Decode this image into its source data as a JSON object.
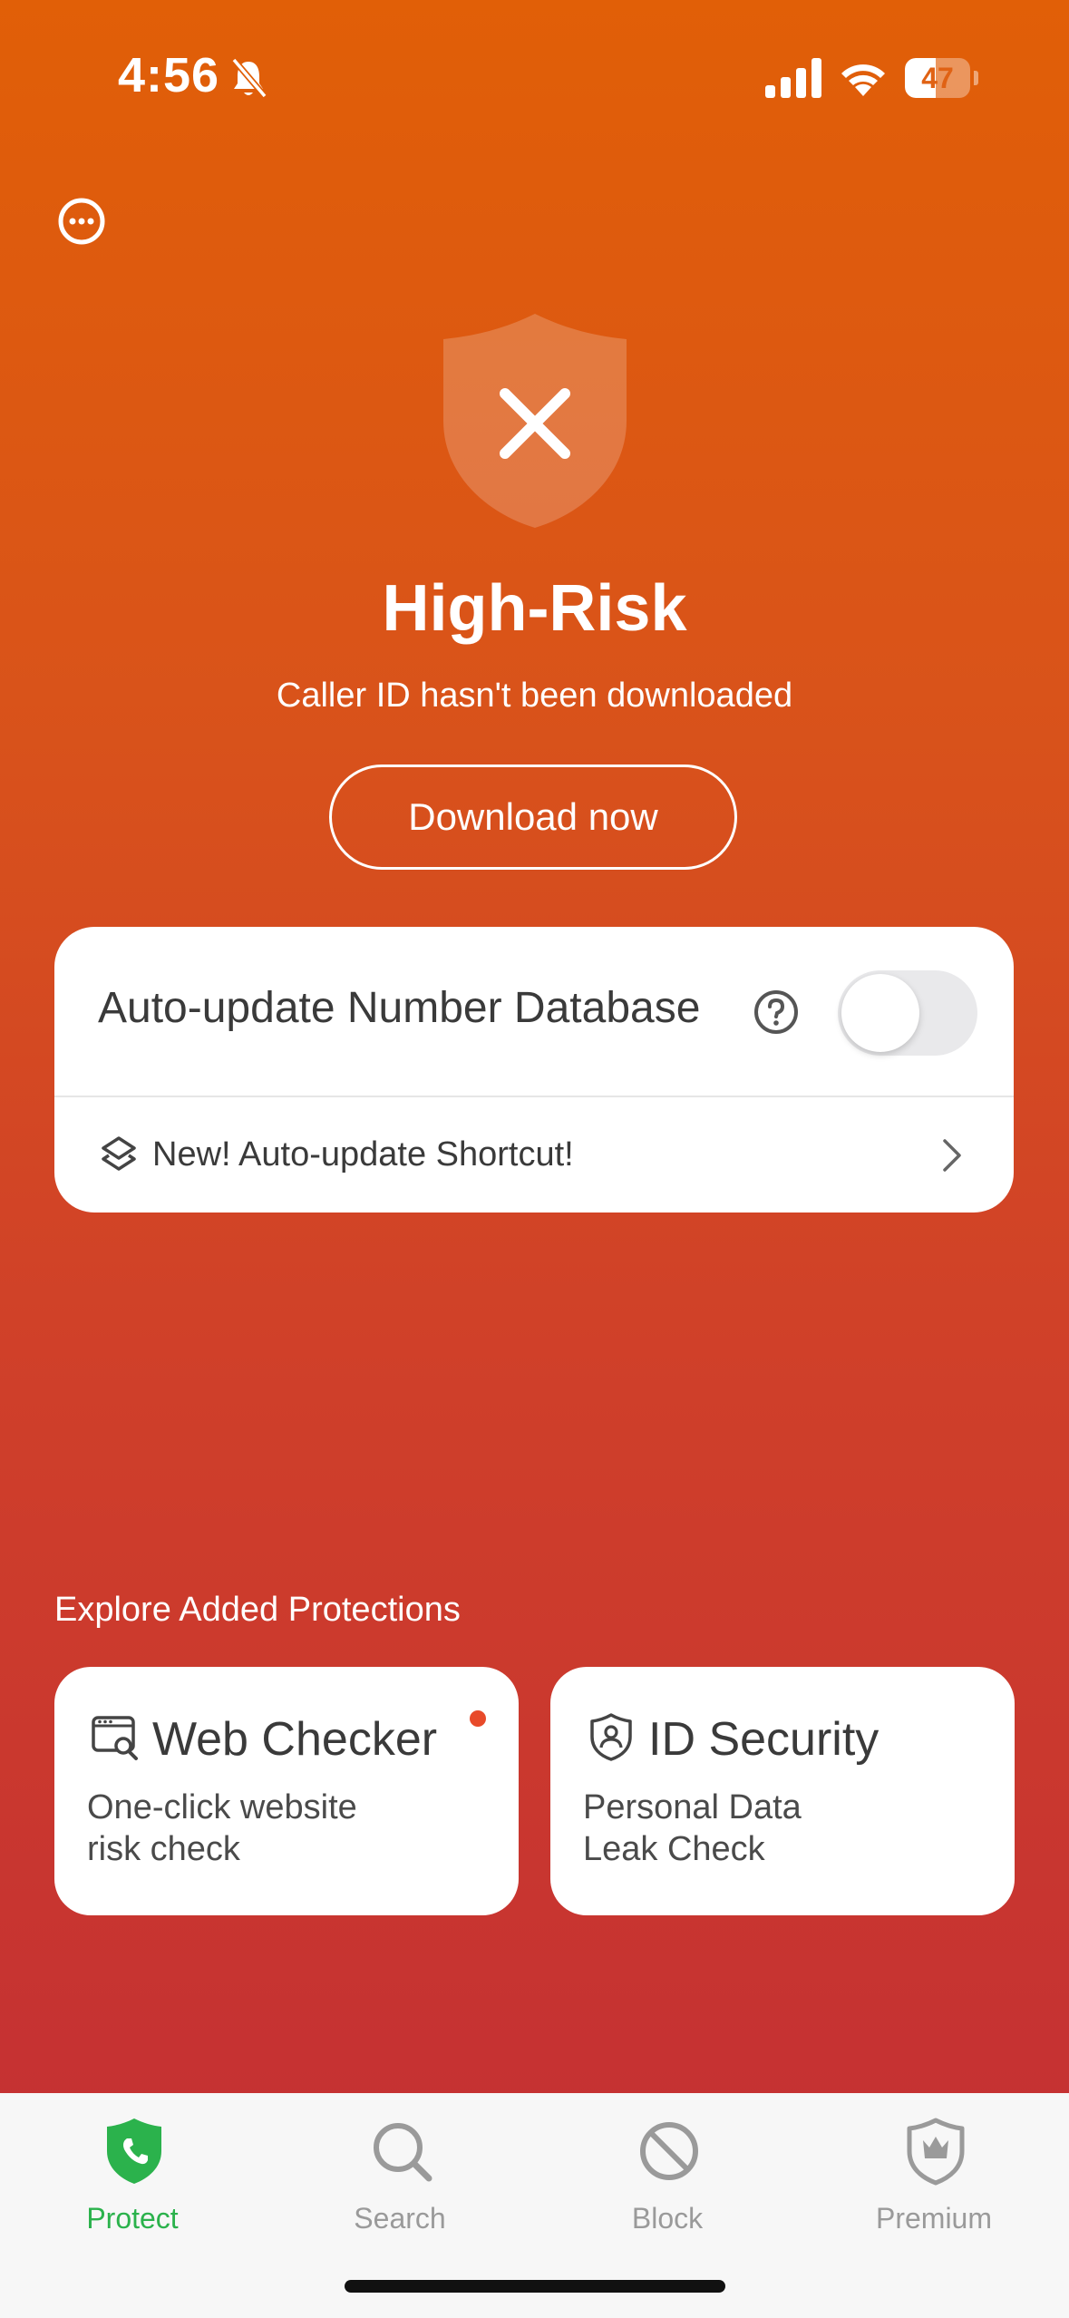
{
  "status_bar": {
    "time": "4:56",
    "battery_level": 47,
    "battery_text": "47"
  },
  "hero": {
    "title": "High-Risk",
    "subtitle": "Caller ID hasn't been downloaded",
    "download_label": "Download now"
  },
  "settings_card": {
    "auto_update_label": "Auto-update Number Database",
    "auto_update_enabled": false,
    "shortcut_label": "New! Auto-update Shortcut!"
  },
  "explore": {
    "title": "Explore Added Protections",
    "cards": [
      {
        "title": "Web Checker",
        "desc_line1": "One-click website",
        "desc_line2": "risk check",
        "icon": "web-check-icon",
        "has_notification": true
      },
      {
        "title": "ID Security",
        "desc_line1": "Personal Data",
        "desc_line2": "Leak Check",
        "icon": "id-shield-icon",
        "has_notification": false
      }
    ]
  },
  "tabs": [
    {
      "label": "Protect",
      "icon": "shield-phone-icon",
      "active": true
    },
    {
      "label": "Search",
      "icon": "search-icon",
      "active": false
    },
    {
      "label": "Block",
      "icon": "block-icon",
      "active": false
    },
    {
      "label": "Premium",
      "icon": "crown-shield-icon",
      "active": false
    }
  ],
  "colors": {
    "gradient_top": "#e15f07",
    "gradient_bottom": "#c22d35",
    "active_tab": "#2bb24c",
    "inactive_tab": "#9a9a9a",
    "notification_dot": "#e84a2a"
  }
}
